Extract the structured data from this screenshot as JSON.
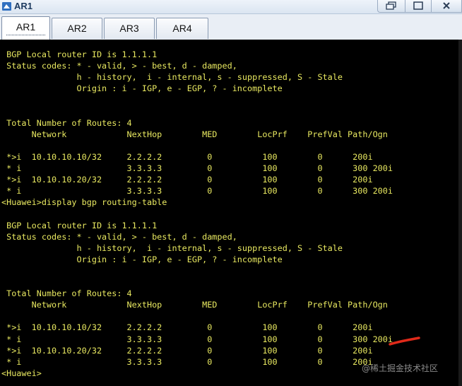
{
  "window": {
    "title": "AR1"
  },
  "tabs": [
    {
      "label": "AR1",
      "active": true
    },
    {
      "label": "AR2",
      "active": false
    },
    {
      "label": "AR3",
      "active": false
    },
    {
      "label": "AR4",
      "active": false
    }
  ],
  "terminal": {
    "text_color": "#e8e860",
    "background": "#000000",
    "lines": [
      " BGP Local router ID is 1.1.1.1",
      " Status codes: * - valid, > - best, d - damped,",
      "               h - history,  i - internal, s - suppressed, S - Stale",
      "               Origin : i - IGP, e - EGP, ? - incomplete",
      "",
      "",
      " Total Number of Routes: 4",
      "      Network            NextHop        MED        LocPrf    PrefVal Path/Ogn",
      "",
      " *>i  10.10.10.10/32     2.2.2.2         0          100        0      200i",
      " * i                     3.3.3.3         0          100        0      300 200i",
      " *>i  10.10.10.20/32     2.2.2.2         0          100        0      200i",
      " * i                     3.3.3.3         0          100        0      300 200i",
      "<Huawei>display bgp routing-table",
      "",
      " BGP Local router ID is 1.1.1.1",
      " Status codes: * - valid, > - best, d - damped,",
      "               h - history,  i - internal, s - suppressed, S - Stale",
      "               Origin : i - IGP, e - EGP, ? - incomplete",
      "",
      "",
      " Total Number of Routes: 4",
      "      Network            NextHop        MED        LocPrf    PrefVal Path/Ogn",
      "",
      " *>i  10.10.10.10/32     2.2.2.2         0          100        0      200i",
      " * i                     3.3.3.3         0          100        0      300 200i",
      " *>i  10.10.10.20/32     2.2.2.2         0          100        0      200i",
      " * i                     3.3.3.3         0          100        0      200i",
      "<Huawei>"
    ]
  },
  "annotation": {
    "color": "#e02a1a"
  },
  "watermark": "@稀土掘金技术社区"
}
